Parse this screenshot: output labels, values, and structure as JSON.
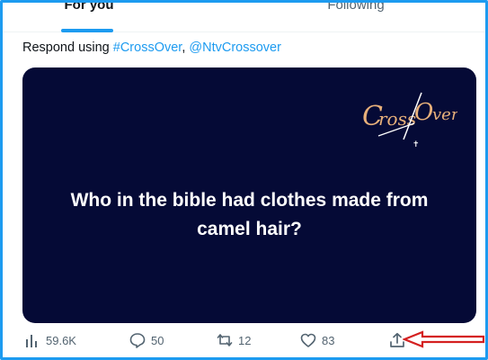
{
  "tabs": [
    {
      "label": "For you",
      "active": true
    },
    {
      "label": "Following",
      "active": false
    }
  ],
  "tweet": {
    "text_prefix": "Respond using ",
    "hashtag": "#CrossOver",
    "separator": ", ",
    "mention": "@NtvCrossover"
  },
  "card": {
    "logo_text": "CrossOver",
    "question": "Who in the bible had clothes made from camel hair?"
  },
  "actions": {
    "views": "59.6K",
    "replies": "50",
    "reposts": "12",
    "likes": "83"
  },
  "colors": {
    "accent": "#1d9bf0",
    "card_bg": "#050a36",
    "logo": "#e8b07a",
    "annotation": "#d42020",
    "muted": "#536471"
  }
}
